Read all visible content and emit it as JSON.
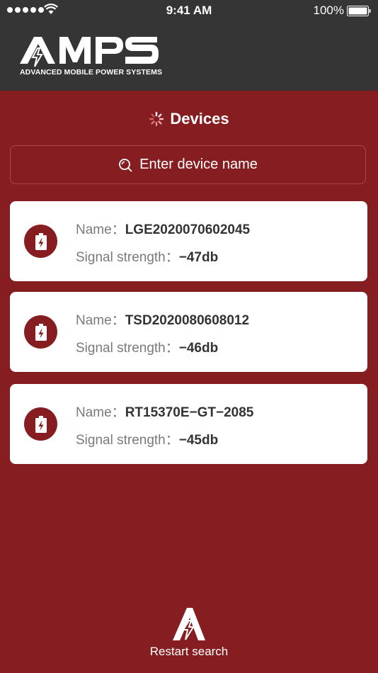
{
  "status_bar": {
    "time": "9:41 AM",
    "battery_percent": "100%",
    "icons": [
      "signal-dots-icon",
      "wifi-icon",
      "battery-icon"
    ]
  },
  "brand": {
    "logo_text": "AMPS",
    "tagline": "ADVANCED MOBILE POWER SYSTEMS"
  },
  "page": {
    "title": "Devices",
    "title_icon": "loading-spinner-icon"
  },
  "search": {
    "placeholder": "Enter device name",
    "icon": "search-icon"
  },
  "devices": [
    {
      "name_label": "Name：",
      "name": "LGE2020070602045",
      "signal_label": "Signal strength：",
      "signal": "−47db"
    },
    {
      "name_label": "Name：",
      "name": "TSD2020080608012",
      "signal_label": "Signal strength：",
      "signal": "−46db"
    },
    {
      "name_label": "Name：",
      "name": "RT15370E−GT−2085",
      "signal_label": "Signal strength：",
      "signal": "−45db"
    }
  ],
  "footer": {
    "restart_label": "Restart search",
    "icon": "amps-bolt-icon"
  },
  "colors": {
    "background": "#861e21",
    "header": "#353535",
    "card": "#ffffff",
    "text_muted": "#7a7a7a",
    "text_strong": "#333333"
  }
}
